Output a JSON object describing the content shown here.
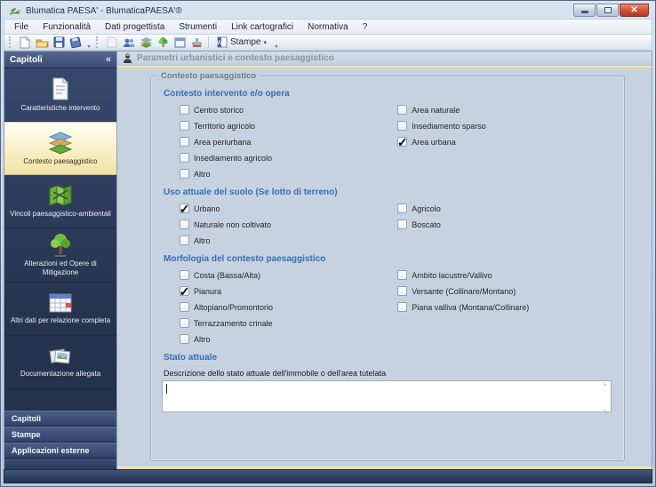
{
  "window": {
    "title": "Blumatica PAESA' - BlumaticaPAESA'®"
  },
  "menu": {
    "items": [
      "File",
      "Funzionalità",
      "Dati progettista",
      "Strumenti",
      "Link cartografici",
      "Normativa",
      "?"
    ]
  },
  "toolbar": {
    "stampe_label": "Stampe",
    "dropdown_arrow": "▾",
    "button_icons": [
      "new-document",
      "open-folder",
      "save",
      "save-as",
      "disabled-action",
      "contacts",
      "landscape",
      "tree",
      "preview-window",
      "stamp",
      "word-document"
    ]
  },
  "sidebar": {
    "header": "Capitoli",
    "collapse_glyph": "«",
    "items": [
      {
        "label": "Caratteristiche intervento"
      },
      {
        "label": "Contesto paesaggistico"
      },
      {
        "label": "Vincoli paesaggistico-ambientali"
      },
      {
        "label": "Alterazioni ed Opere di Mitigazione"
      },
      {
        "label": "Altri dati per relazione completa"
      },
      {
        "label": "Documentazione allegata"
      }
    ],
    "bottom_items": [
      {
        "label": "Capitoli"
      },
      {
        "label": "Stampe"
      },
      {
        "label": "Applicazioni esterne"
      }
    ]
  },
  "main": {
    "header_title": "Parametri urbanistici e contesto paesaggistico",
    "groupbox_title": "Contesto paesaggistico",
    "sections": [
      {
        "heading": "Contesto intervento e/o opera",
        "left": [
          {
            "label": "Centro storico",
            "mark": ""
          },
          {
            "label": "Territorio agricolo",
            "mark": ""
          },
          {
            "label": "Area periurbana",
            "mark": ""
          },
          {
            "label": "Insediamento agricolo",
            "mark": ""
          },
          {
            "label": "Altro",
            "mark": ""
          }
        ],
        "right": [
          {
            "label": "Area naturale",
            "mark": ""
          },
          {
            "label": "Insediamento sparso",
            "mark": ""
          },
          {
            "label": "Area urbana",
            "mark": "✓"
          }
        ]
      },
      {
        "heading": "Uso attuale del suolo (Se lotto di terreno)",
        "left": [
          {
            "label": "Urbano",
            "mark": "✓"
          },
          {
            "label": "Naturale non coltivato",
            "mark": ""
          },
          {
            "label": "Altro",
            "mark": ""
          }
        ],
        "right": [
          {
            "label": "Agricolo",
            "mark": ""
          },
          {
            "label": "Boscato",
            "mark": ""
          }
        ]
      },
      {
        "heading": "Morfologia del contesto paesaggistico",
        "left": [
          {
            "label": "Costa (Bassa/Alta)",
            "mark": ""
          },
          {
            "label": "Pianura",
            "mark": "✓"
          },
          {
            "label": "Altopiano/Promontorio",
            "mark": ""
          },
          {
            "label": "Terrazzamento crinale",
            "mark": ""
          },
          {
            "label": "Altro",
            "mark": ""
          }
        ],
        "right": [
          {
            "label": "Ambito lacustre/Vallivo",
            "mark": ""
          },
          {
            "label": "Versante (Collinare/Montano)",
            "mark": ""
          },
          {
            "label": "Piana valliva (Montana/Collinare)",
            "mark": ""
          }
        ]
      }
    ],
    "stato": {
      "heading": "Stato attuale",
      "description_label": "Descrizione dello stato attuale dell'immobile o dell'area tutelata",
      "value": ""
    }
  },
  "colors": {
    "sidebar_navy": "#2b3a5c",
    "selected_item_bg": "#f8edc0",
    "accent_gold": "#e3d08f",
    "heading_blue": "#3a6db3",
    "content_bg": "#c6d2e0"
  }
}
